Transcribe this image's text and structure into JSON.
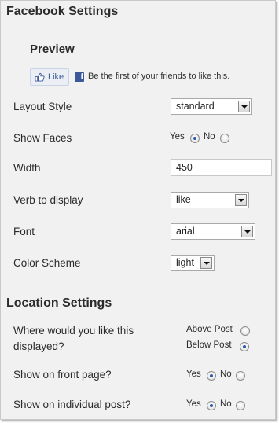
{
  "facebook_settings": {
    "title": "Facebook Settings",
    "preview_title": "Preview",
    "like_button_label": "Like",
    "friends_text": "Be the first of your friends to like this.",
    "fb_logo_letter": "f",
    "layout_style": {
      "label": "Layout Style",
      "value": "standard"
    },
    "show_faces": {
      "label": "Show Faces",
      "yes": "Yes",
      "no": "No",
      "selected": "Yes"
    },
    "width": {
      "label": "Width",
      "value": "450"
    },
    "verb": {
      "label": "Verb to display",
      "value": "like"
    },
    "font": {
      "label": "Font",
      "value": "arial"
    },
    "color_scheme": {
      "label": "Color Scheme",
      "value": "light"
    }
  },
  "location_settings": {
    "title": "Location Settings",
    "where_label": "Where would you like this displayed?",
    "above_post": "Above Post",
    "below_post": "Below Post",
    "selected_position": "Below Post",
    "front_page": {
      "label": "Show on front page?",
      "yes": "Yes",
      "no": "No",
      "selected": "Yes"
    },
    "individual_post": {
      "label": "Show on individual post?",
      "yes": "Yes",
      "no": "No",
      "selected": "Yes"
    }
  },
  "colors": {
    "facebook_blue": "#3b5998",
    "radio_selected": "#2a56b2"
  }
}
